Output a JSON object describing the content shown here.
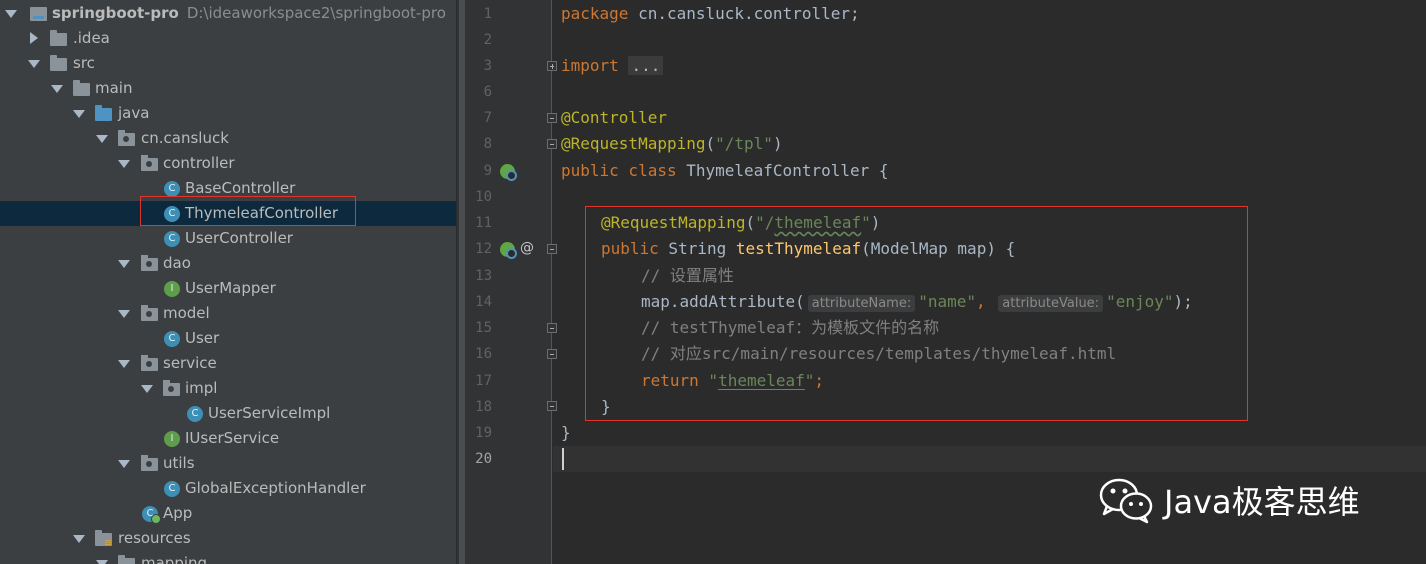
{
  "tree": {
    "root": {
      "name": "springboot-pro",
      "path": "D:\\ideaworkspace2\\springboot-pro"
    },
    "items": [
      {
        "label": ".idea"
      },
      {
        "label": "src"
      },
      {
        "label": "main"
      },
      {
        "label": "java"
      },
      {
        "label": "cn.cansluck"
      },
      {
        "label": "controller"
      },
      {
        "label": "BaseController",
        "badge": "C"
      },
      {
        "label": "ThymeleafController",
        "badge": "C"
      },
      {
        "label": "UserController",
        "badge": "C"
      },
      {
        "label": "dao"
      },
      {
        "label": "UserMapper",
        "badge": "I"
      },
      {
        "label": "model"
      },
      {
        "label": "User",
        "badge": "C"
      },
      {
        "label": "service"
      },
      {
        "label": "impl"
      },
      {
        "label": "UserServiceImpl",
        "badge": "C"
      },
      {
        "label": "IUserService",
        "badge": "I"
      },
      {
        "label": "utils"
      },
      {
        "label": "GlobalExceptionHandler",
        "badge": "C"
      },
      {
        "label": "App",
        "badge": "C"
      },
      {
        "label": "resources"
      },
      {
        "label": "mapping"
      }
    ],
    "selected": "ThymeleafController"
  },
  "editor": {
    "line_numbers": [
      "1",
      "2",
      "3",
      "6",
      "7",
      "8",
      "9",
      "10",
      "11",
      "12",
      "13",
      "14",
      "15",
      "16",
      "17",
      "18",
      "19",
      "20"
    ],
    "current_line": "20",
    "l1": {
      "kw": "package",
      "rest": " cn.cansluck.controller;"
    },
    "l3": {
      "kw": "import",
      "folded": "..."
    },
    "l7": {
      "ann": "@Controller"
    },
    "l8": {
      "ann": "@RequestMapping",
      "open": "(",
      "str": "\"/tpl\"",
      "close": ")"
    },
    "l9": {
      "kw": "public class",
      "rest": " ThymeleafController {"
    },
    "l11": {
      "ann": "@RequestMapping",
      "open": "(",
      "q1": "\"/",
      "str": "themeleaf",
      "q2": "\"",
      "close": ")"
    },
    "l12": {
      "kw": "public",
      "type": " String ",
      "fn": "testThymeleaf",
      "rest": "(ModelMap map) {"
    },
    "l13": {
      "cmt": "// 设置属性"
    },
    "l14": {
      "call": "map.addAttribute(",
      "hint1": "attributeName:",
      "arg1": "\"name\"",
      "comma": ",",
      "hint2": "attributeValue:",
      "arg2": "\"enjoy\"",
      "end": ");"
    },
    "l15": {
      "cmt": "// testThymeleaf：为模板文件的名称"
    },
    "l16": {
      "cmt": "// 对应src/main/resources/templates/thymeleaf.html"
    },
    "l17": {
      "kw": "return",
      "q1": " \"",
      "str": "themeleaf",
      "q2": "\"",
      "end": ";"
    },
    "l18": {
      "text": "}"
    },
    "l19": {
      "text": "}"
    },
    "gutter_at": "@"
  },
  "watermark": {
    "text": "Java极客思维",
    "icon": "wechat-icon"
  },
  "colors": {
    "keyword": "#cc7832",
    "annotation": "#bbb529",
    "string": "#6a8759",
    "method": "#ffc66d",
    "comment": "#808080",
    "highlight_box": "#e0342d"
  }
}
